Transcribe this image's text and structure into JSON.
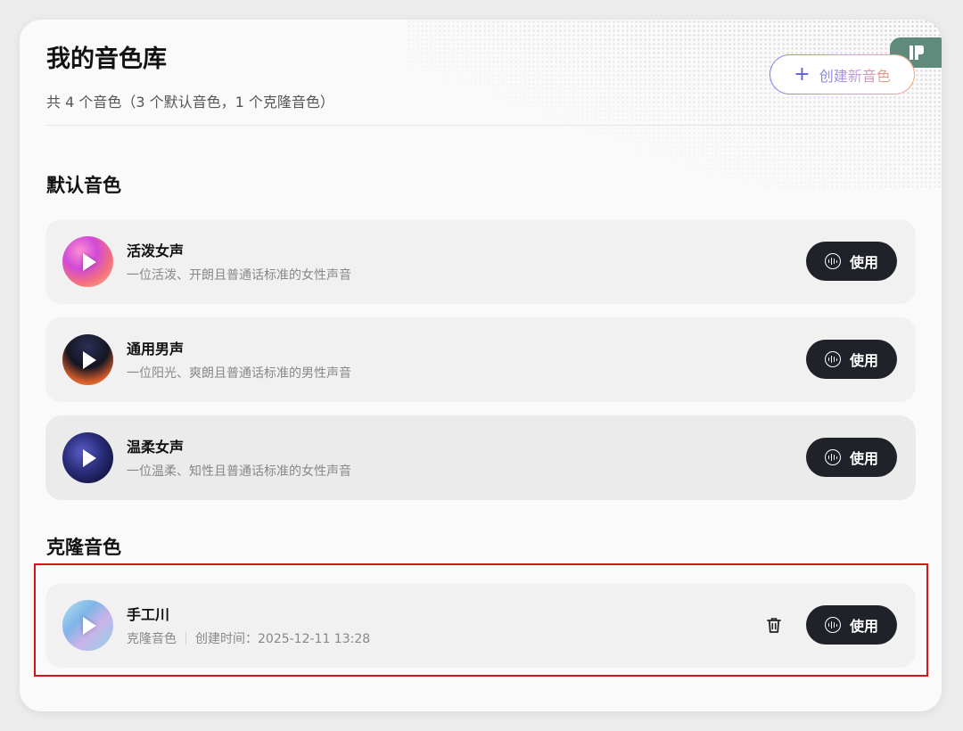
{
  "header": {
    "title": "我的音色库",
    "subtitle": "共 4 个音色（3 个默认音色，1 个克隆音色）",
    "create_button": "创建新音色"
  },
  "sections": {
    "default_title": "默认音色",
    "clone_title": "克隆音色"
  },
  "default_voices": [
    {
      "name": "活泼女声",
      "desc": "一位活泼、开朗且普通话标准的女性声音",
      "use_label": "使用"
    },
    {
      "name": "通用男声",
      "desc": "一位阳光、爽朗且普通话标准的男性声音",
      "use_label": "使用"
    },
    {
      "name": "温柔女声",
      "desc": "一位温柔、知性且普通话标准的女性声音",
      "use_label": "使用"
    }
  ],
  "clone_voices": [
    {
      "name": "手工川",
      "type": "克隆音色",
      "created": "创建时间：2025-12-11 13:28",
      "use_label": "使用"
    }
  ],
  "colors": {
    "button_dark": "#1f2229",
    "highlight": "#d6141b",
    "logo_bg": "#5f8b7c"
  },
  "icons": [
    "plus-icon",
    "play-icon",
    "voice-wave-icon",
    "trash-icon",
    "app-logo-icon"
  ]
}
